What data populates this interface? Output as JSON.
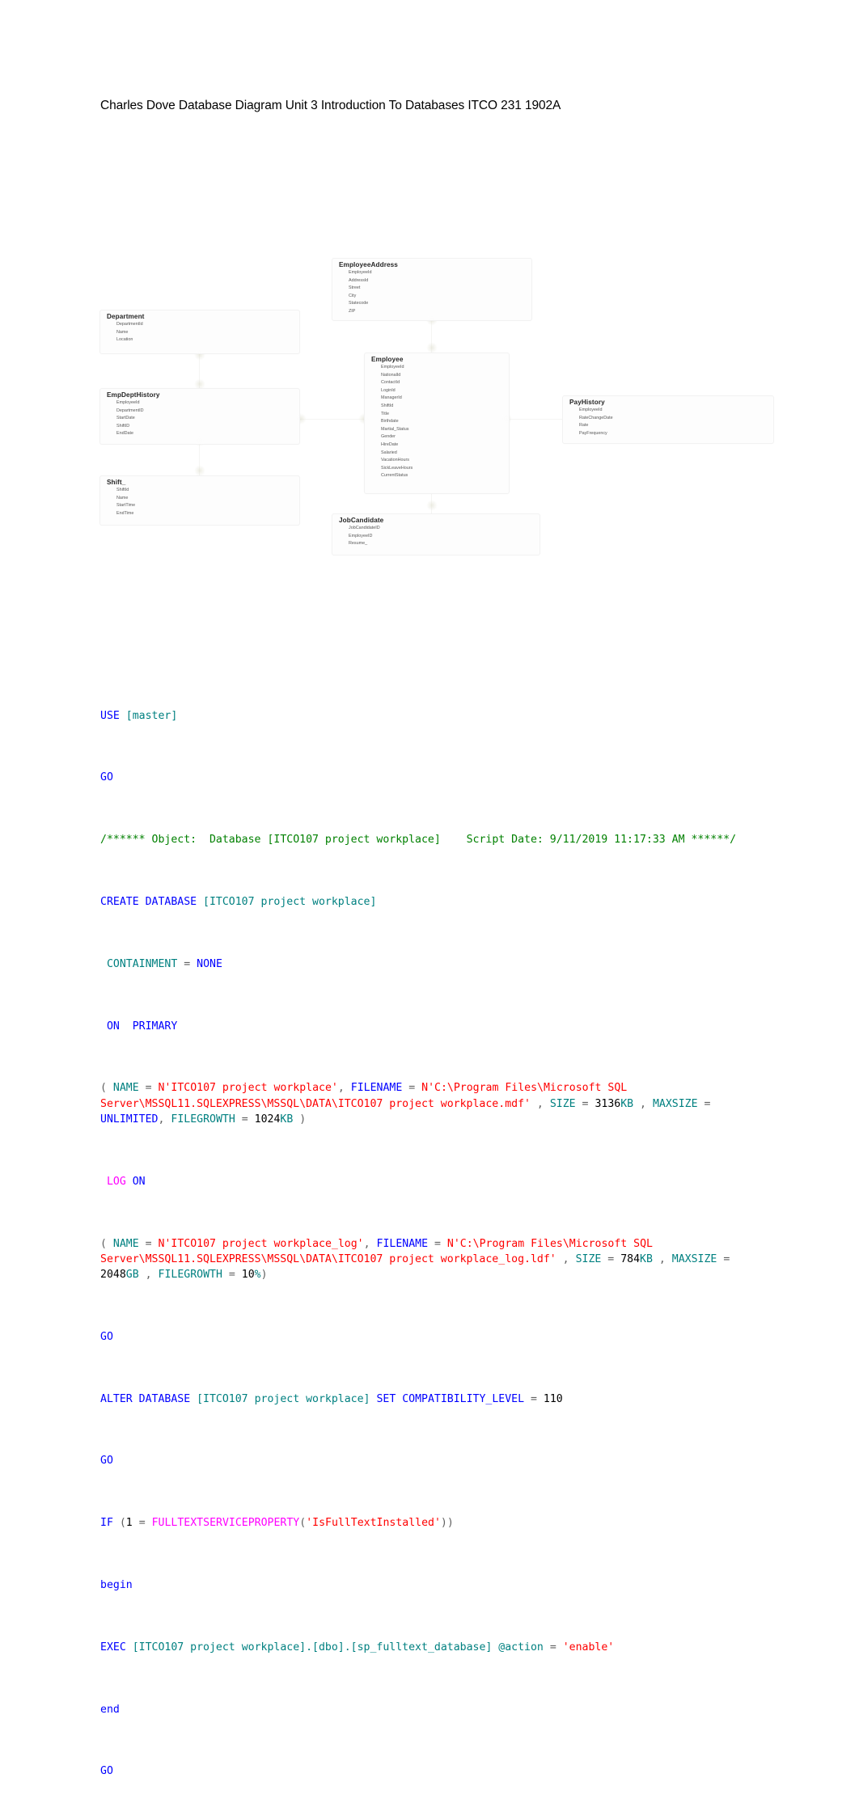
{
  "document": {
    "title": "Charles Dove Database Diagram Unit 3 Introduction To Databases ITCO 231 1902A"
  },
  "diagram": {
    "tables": [
      {
        "name": "EmployeeAddress",
        "fields": [
          "EmployeeId",
          "AddressId",
          "Street",
          "City",
          "Statecode",
          "ZIP"
        ]
      },
      {
        "name": "Department",
        "fields": [
          "DepartmentId",
          "Name",
          "Location"
        ]
      },
      {
        "name": "EmpDeptHistory",
        "fields": [
          "EmployeeId",
          "DepartmentID",
          "StartDate",
          "ShiftID",
          "EndDate"
        ]
      },
      {
        "name": "Shift_",
        "fields": [
          "ShiftId",
          "Name",
          "StartTime",
          "EndTime"
        ]
      },
      {
        "name": "Employee",
        "fields": [
          "EmployeeId",
          "NationalId",
          "ContactId",
          "LoginId",
          "ManagerId",
          "ShiftId",
          "Title",
          "Birthdate",
          "Martial_Status",
          "Gender",
          "HireDate",
          "Salaried",
          "VacationHours",
          "SickLeaveHours",
          "CurrentStatus"
        ]
      },
      {
        "name": "PayHistory",
        "fields": [
          "EmployeeId",
          "RateChangeDate",
          "Rate",
          "PayFrequency"
        ]
      },
      {
        "name": "JobCandidate",
        "fields": [
          "JobCandidateID",
          "EmployeeID",
          "Resume_"
        ]
      }
    ]
  },
  "sql": {
    "colors": {
      "keyword": "#0000ff",
      "identifier": "#008080",
      "string": "#ff0000",
      "comment": "#008000",
      "function": "#ff00ff",
      "number": "#000000"
    },
    "lines": [
      "USE [master]",
      "GO",
      "/****** Object:  Database [ITCO107 project workplace]    Script Date: 9/11/2019 11:17:33 AM ******/",
      "CREATE DATABASE [ITCO107 project workplace]",
      " CONTAINMENT = NONE",
      " ON  PRIMARY",
      "( NAME = N'ITCO107 project workplace', FILENAME = N'C:\\Program Files\\Microsoft SQL Server\\MSSQL11.SQLEXPRESS\\MSSQL\\DATA\\ITCO107 project workplace.mdf' , SIZE = 3136KB , MAXSIZE = UNLIMITED, FILEGROWTH = 1024KB )",
      " LOG ON",
      "( NAME = N'ITCO107 project workplace_log', FILENAME = N'C:\\Program Files\\Microsoft SQL Server\\MSSQL11.SQLEXPRESS\\MSSQL\\DATA\\ITCO107 project workplace_log.ldf' , SIZE = 784KB , MAXSIZE = 2048GB , FILEGROWTH = 10%)",
      "GO",
      "ALTER DATABASE [ITCO107 project workplace] SET COMPATIBILITY_LEVEL = 110",
      "GO",
      "IF (1 = FULLTEXTSERVICEPROPERTY('IsFullTextInstalled'))",
      "begin",
      "EXEC [ITCO107 project workplace].[dbo].[sp_fulltext_database] @action = 'enable'",
      "end",
      "GO"
    ],
    "tokens": {
      "use": "USE",
      "master": "[master]",
      "go": "GO",
      "comment_open": "/****** Object:  Database ",
      "comment_db": "[ITCO107 project workplace]",
      "comment_date": "    Script Date: 9/11/2019 11:17:33 AM ******/",
      "create_database": "CREATE DATABASE",
      "db_name": "[ITCO107 project workplace]",
      "containment": " CONTAINMENT",
      "eq": "=",
      "none": "NONE",
      "on_primary_on": " ON",
      "on_primary_primary": "PRIMARY",
      "paren_open": "(",
      "paren_close": ")",
      "name_kw": "NAME",
      "data_name_str": "N'ITCO107 project workplace'",
      "filename_kw": "FILENAME",
      "data_file_str": "N'C:\\Program Files\\Microsoft SQL Server\\MSSQL11.SQLEXPRESS\\MSSQL\\DATA\\ITCO107 project workplace.mdf'",
      "size_kw": "SIZE",
      "data_size_num": "3136",
      "kb": "KB",
      "maxsize_kw": "MAXSIZE",
      "unlimited": "UNLIMITED",
      "filegrowth_kw": "FILEGROWTH",
      "data_growth_num": "1024",
      "log_kw": " LOG",
      "on_kw": "ON",
      "log_name_str": "N'ITCO107 project workplace_log'",
      "log_file_str": "N'C:\\Program Files\\Microsoft SQL Server\\MSSQL11.SQLEXPRESS\\MSSQL\\DATA\\ITCO107 project workplace_log.ldf'",
      "log_size_num": "784",
      "log_maxsize_num": "2048",
      "gb": "GB",
      "log_growth_num": "10",
      "pct": "%",
      "alter_database": "ALTER DATABASE",
      "set_compat": "SET COMPATIBILITY_LEVEL",
      "compat_level": "110",
      "if_kw": "IF",
      "one": "1",
      "fulltext_fn": "FULLTEXTSERVICEPROPERTY",
      "isfulltext_str": "'IsFullTextInstalled'",
      "begin_kw": "begin",
      "exec_kw": "EXEC",
      "exec_target": "[ITCO107 project workplace].[dbo].[sp_fulltext_database]",
      "action_kw": "@action",
      "enable_str": "'enable'",
      "end_kw": "end",
      "comma": ",",
      "dot": "."
    }
  }
}
